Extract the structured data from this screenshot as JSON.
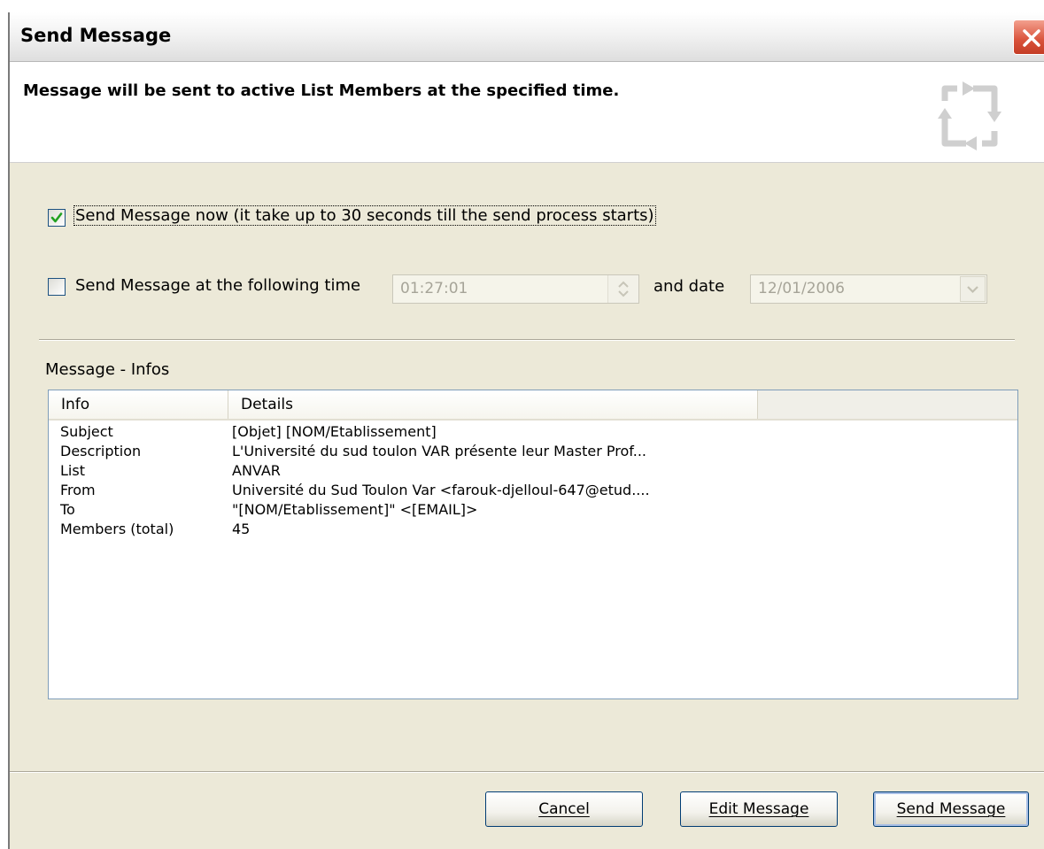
{
  "window": {
    "title": "Send Message",
    "header_text": "Message will be sent to active List Members at the specified time."
  },
  "options": {
    "send_now": {
      "label": "Send Message now (it take up to 30 seconds till the send process starts)",
      "checked": true
    },
    "send_at_time": {
      "label": "Send Message at the following time",
      "checked": false,
      "time_value": "01:27:01",
      "date_label": "and date",
      "date_value": "12/01/2006"
    }
  },
  "infos": {
    "section_label": "Message - Infos",
    "columns": [
      "Info",
      "Details"
    ],
    "rows": [
      {
        "info": "Subject",
        "details": "[Objet] [NOM/Etablissement]"
      },
      {
        "info": "Description",
        "details": "L'Université du sud toulon VAR présente leur Master Prof..."
      },
      {
        "info": "List",
        "details": "ANVAR"
      },
      {
        "info": "From",
        "details": "Université du Sud Toulon Var <farouk-djelloul-647@etud...."
      },
      {
        "info": "To",
        "details": "\"[NOM/Etablissement]\" <[EMAIL]>"
      },
      {
        "info": "Members (total)",
        "details": "45"
      }
    ]
  },
  "buttons": {
    "cancel": "Cancel",
    "edit": "Edit Message",
    "send": "Send Message"
  },
  "icons": {
    "close": "close-icon",
    "header": "refresh-arrows-icon",
    "checkmark": "checkmark-icon",
    "spin": "spin-updown-icon",
    "dropdown": "chevron-down-icon"
  },
  "colors": {
    "checkmark": "#21a121",
    "close_button": "#d9513a",
    "dialog_background": "#ece9d8"
  }
}
